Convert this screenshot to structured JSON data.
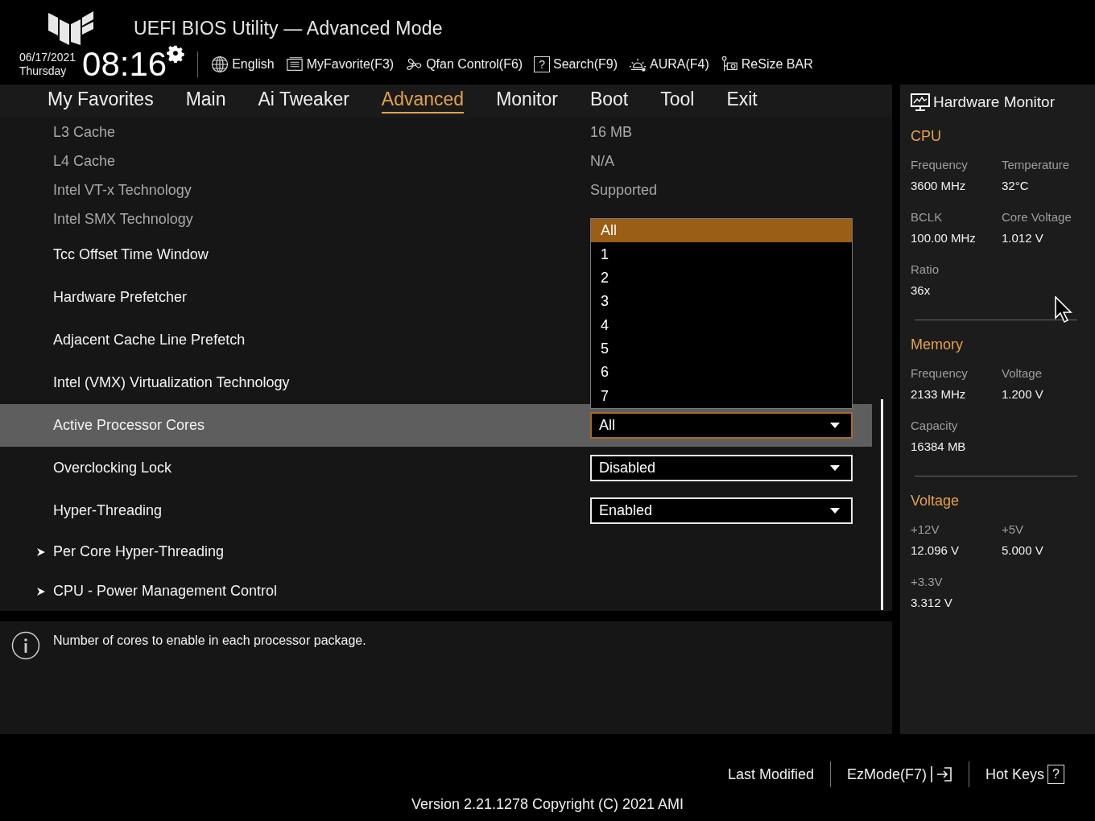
{
  "header": {
    "title": "UEFI BIOS Utility — Advanced Mode",
    "date": "06/17/2021",
    "day": "Thursday",
    "time": "08:16",
    "toolbar": [
      {
        "kind": "globe",
        "label": "English"
      },
      {
        "kind": "favorite",
        "label": "MyFavorite(F3)"
      },
      {
        "kind": "fan",
        "label": "Qfan Control(F6)"
      },
      {
        "kind": "search",
        "glyph": "?",
        "label": "Search(F9)"
      },
      {
        "kind": "aura",
        "label": "AURA(F4)"
      },
      {
        "kind": "card",
        "label": "ReSize BAR"
      }
    ]
  },
  "tabs": [
    {
      "label": "My Favorites",
      "selected": false
    },
    {
      "label": "Main",
      "selected": false
    },
    {
      "label": "Ai Tweaker",
      "selected": false
    },
    {
      "label": "Advanced",
      "selected": true
    },
    {
      "label": "Monitor",
      "selected": false
    },
    {
      "label": "Boot",
      "selected": false
    },
    {
      "label": "Tool",
      "selected": false
    },
    {
      "label": "Exit",
      "selected": false
    }
  ],
  "settings": [
    {
      "kind": "info",
      "label": "L3 Cache",
      "value": "16 MB"
    },
    {
      "kind": "info",
      "label": "L4 Cache",
      "value": "N/A"
    },
    {
      "kind": "info",
      "label": "Intel VT-x Technology",
      "value": "Supported"
    },
    {
      "kind": "info",
      "label": "Intel SMX Technology"
    },
    {
      "kind": "setting",
      "label": "Tcc Offset Time Window",
      "selected": false
    },
    {
      "kind": "setting",
      "label": "Hardware Prefetcher",
      "selected": false
    },
    {
      "kind": "setting",
      "label": "Adjacent Cache Line Prefetch",
      "selected": false
    },
    {
      "kind": "setting",
      "label": "Intel (VMX) Virtualization Technology",
      "selected": false
    },
    {
      "kind": "setting",
      "label": "Active Processor Cores",
      "selected": true,
      "value": "All",
      "options": [
        {
          "label": "All",
          "selected": true
        },
        {
          "label": "1",
          "selected": false
        },
        {
          "label": "2",
          "selected": false
        },
        {
          "label": "3",
          "selected": false
        },
        {
          "label": "4",
          "selected": false
        },
        {
          "label": "5",
          "selected": false
        },
        {
          "label": "6",
          "selected": false
        },
        {
          "label": "7",
          "selected": false
        }
      ]
    },
    {
      "kind": "setting",
      "label": "Overclocking Lock",
      "selected": false,
      "value": "Disabled"
    },
    {
      "kind": "setting",
      "label": "Hyper-Threading",
      "selected": false,
      "value": "Enabled"
    },
    {
      "kind": "submenu",
      "label": "Per Core Hyper-Threading"
    },
    {
      "kind": "submenu",
      "label": "CPU - Power Management Control"
    }
  ],
  "help": "Number of cores to enable in each processor package.",
  "hardware_monitor": {
    "title": "Hardware Monitor",
    "sections": [
      {
        "title": "CPU",
        "items": [
          {
            "label": "Frequency",
            "value": "3600 MHz"
          },
          {
            "label": "Temperature",
            "value": "32°C"
          },
          {
            "label": "BCLK",
            "value": "100.00 MHz"
          },
          {
            "label": "Core Voltage",
            "value": "1.012 V"
          },
          {
            "label": "Ratio",
            "value": "36x"
          }
        ]
      },
      {
        "title": "Memory",
        "items": [
          {
            "label": "Frequency",
            "value": "2133 MHz"
          },
          {
            "label": "Voltage",
            "value": "1.200 V"
          },
          {
            "label": "Capacity",
            "value": "16384 MB"
          }
        ]
      },
      {
        "title": "Voltage",
        "items": [
          {
            "label": "+12V",
            "value": "12.096 V"
          },
          {
            "label": "+5V",
            "value": "5.000 V"
          },
          {
            "label": "+3.3V",
            "value": "3.312 V"
          }
        ]
      }
    ]
  },
  "footer": {
    "buttons": [
      {
        "kind": "plain",
        "label": "Last Modified"
      },
      {
        "kind": "ezmode",
        "label": "EzMode(F7)"
      },
      {
        "kind": "hotkeys",
        "label": "Hot Keys",
        "glyph": "?"
      }
    ],
    "version": "Version 2.21.1278 Copyright (C) 2021 AMI"
  }
}
